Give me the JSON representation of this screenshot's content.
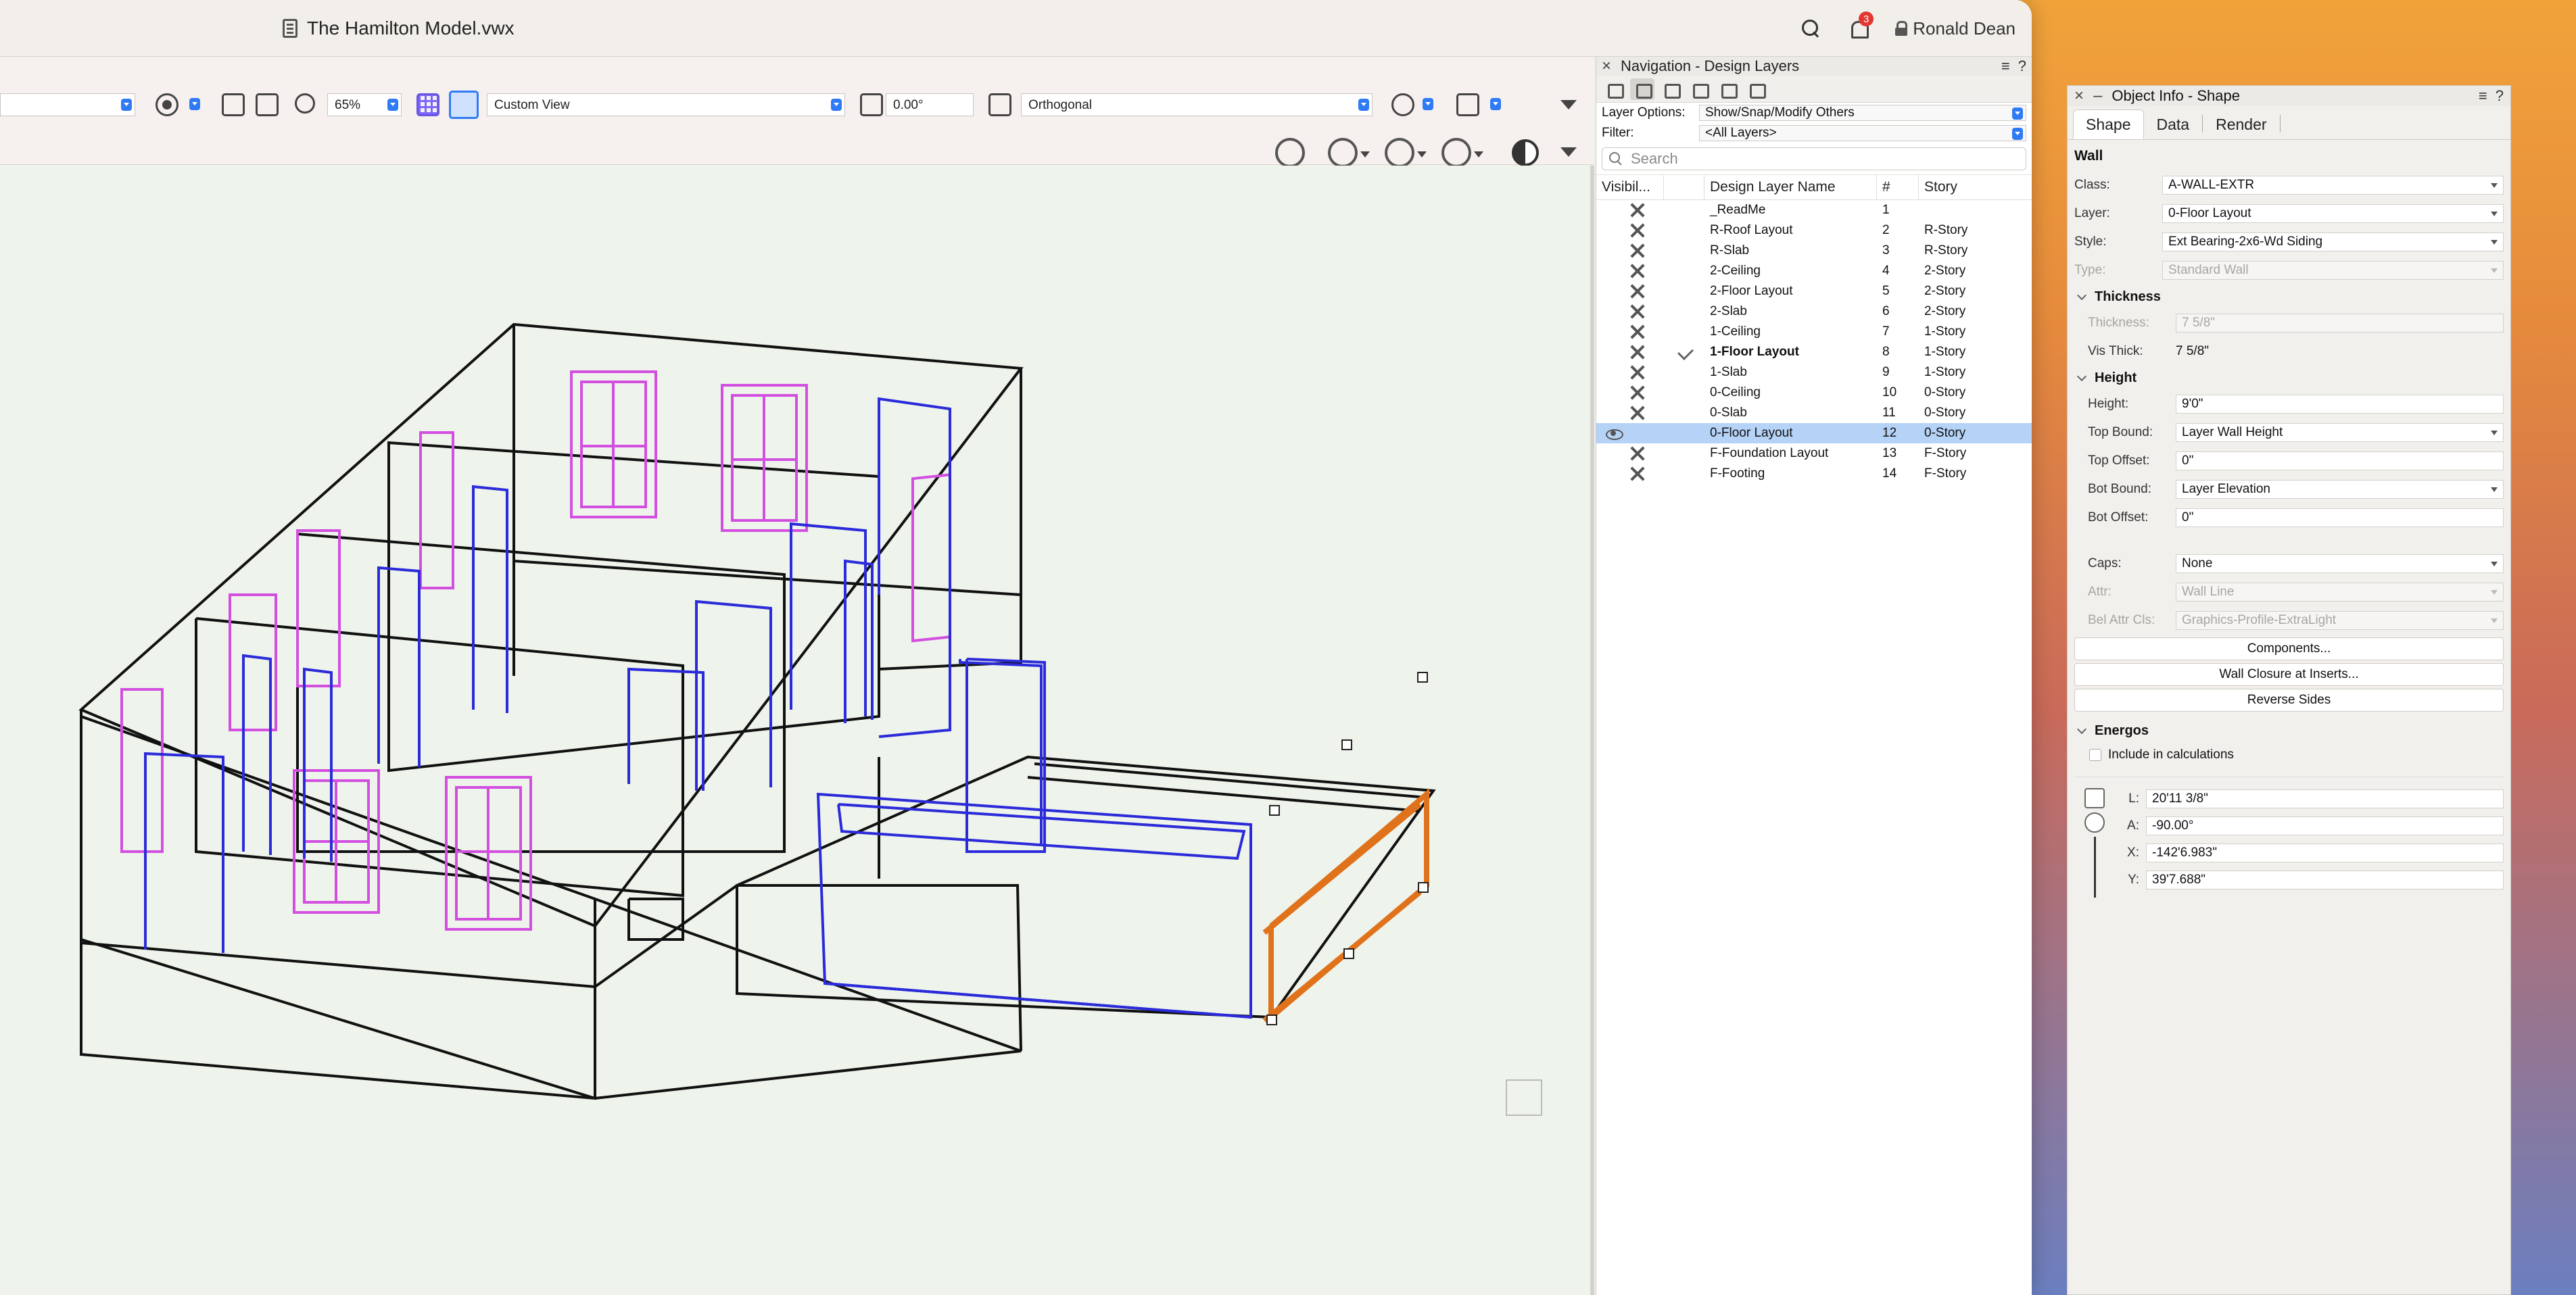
{
  "window": {
    "title": "The Hamilton Model.vwx",
    "notification_count": "3",
    "user_name": "Ronald Dean"
  },
  "viewbar": {
    "zoom": "65%",
    "view": "Custom View",
    "angle": "0.00°",
    "projection": "Orthogonal"
  },
  "nav": {
    "title": "Navigation - Design Layers",
    "layer_options_label": "Layer Options:",
    "layer_options_value": "Show/Snap/Modify Others",
    "filter_label": "Filter:",
    "filter_value": "<All Layers>",
    "search_placeholder": "Search",
    "columns": {
      "visibility": "Visibil...",
      "name": "Design Layer Name",
      "number": "#",
      "story": "Story"
    },
    "layers": [
      {
        "name": "_ReadMe",
        "num": "1",
        "story": ""
      },
      {
        "name": "R-Roof Layout",
        "num": "2",
        "story": "R-Story"
      },
      {
        "name": "R-Slab",
        "num": "3",
        "story": "R-Story"
      },
      {
        "name": "2-Ceiling",
        "num": "4",
        "story": "2-Story"
      },
      {
        "name": "2-Floor Layout",
        "num": "5",
        "story": "2-Story"
      },
      {
        "name": "2-Slab",
        "num": "6",
        "story": "2-Story"
      },
      {
        "name": "1-Ceiling",
        "num": "7",
        "story": "1-Story"
      },
      {
        "name": "1-Floor Layout",
        "num": "8",
        "story": "1-Story"
      },
      {
        "name": "1-Slab",
        "num": "9",
        "story": "1-Story"
      },
      {
        "name": "0-Ceiling",
        "num": "10",
        "story": "0-Story"
      },
      {
        "name": "0-Slab",
        "num": "11",
        "story": "0-Story"
      },
      {
        "name": "0-Floor Layout",
        "num": "12",
        "story": "0-Story"
      },
      {
        "name": "F-Foundation Layout",
        "num": "13",
        "story": "F-Story"
      },
      {
        "name": "F-Footing",
        "num": "14",
        "story": "F-Story"
      }
    ]
  },
  "obj": {
    "title": "Object Info - Shape",
    "tabs": [
      "Shape",
      "Data",
      "Render"
    ],
    "heading": "Wall",
    "class_label": "Class:",
    "class_value": "A-WALL-EXTR",
    "layer_label": "Layer:",
    "layer_value": "0-Floor Layout",
    "style_label": "Style:",
    "style_value": "Ext Bearing-2x6-Wd Siding",
    "type_label": "Type:",
    "type_value": "Standard Wall",
    "thickness_section": "Thickness",
    "thickness_label": "Thickness:",
    "thickness_value": "7 5/8\"",
    "vis_thick_label": "Vis Thick:",
    "vis_thick_value": "7 5/8\"",
    "height_section": "Height",
    "height_label": "Height:",
    "height_value": "9'0\"",
    "top_bound_label": "Top Bound:",
    "top_bound_value": "Layer Wall Height",
    "top_offset_label": "Top Offset:",
    "top_offset_value": "0\"",
    "bot_bound_label": "Bot Bound:",
    "bot_bound_value": "Layer Elevation",
    "bot_offset_label": "Bot Offset:",
    "bot_offset_value": "0\"",
    "caps_label": "Caps:",
    "caps_value": "None",
    "attr_label": "Attr:",
    "attr_value": "Wall Line",
    "bel_attr_label": "Bel Attr Cls:",
    "bel_attr_value": "Graphics-Profile-ExtraLight",
    "components_btn": "Components...",
    "wall_closure_btn": "Wall Closure at Inserts...",
    "reverse_sides_btn": "Reverse Sides",
    "energos_section": "Energos",
    "include_calc": "Include in calculations",
    "l_label": "L:",
    "l_value": "20'11 3/8\"",
    "a_label": "A:",
    "a_value": "-90.00°",
    "x_label": "X:",
    "x_value": "-142'6.983\"",
    "y_label": "Y:",
    "y_value": "39'7.688\""
  },
  "colors": {
    "wall_black": "#111111",
    "door_blue": "#2b2bd9",
    "window_magenta": "#d24fe0",
    "selected_orange": "#e0721c",
    "selection_row": "#b5d2f7"
  }
}
